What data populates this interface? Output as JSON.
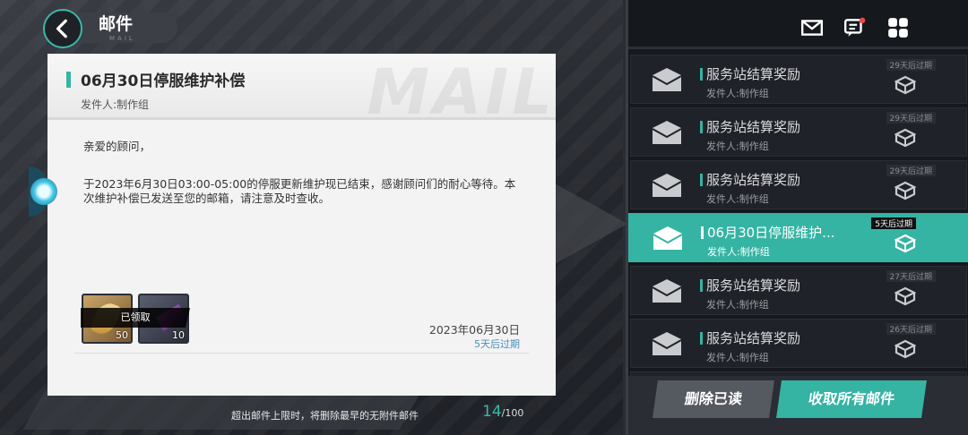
{
  "header": {
    "title": "邮件",
    "subtitle": "MAIL",
    "back_icon": "back-arrow-icon"
  },
  "mail_detail": {
    "watermark": "MAIL",
    "title": "06月30日停服维护补偿",
    "sender_label": "发件人:",
    "sender": "制作组",
    "greeting": "亲爱的顾问，",
    "body": "于2023年6月30日03:00-05:00的停服更新维护现已结束，感谢顾问们的耐心等待。本次维护补偿已发送至您的邮箱，请注意及时查收。",
    "attachments": [
      {
        "icon": "gold-crystal-icon",
        "count": "50"
      },
      {
        "icon": "purple-crystal-icon",
        "count": "10"
      }
    ],
    "claimed_label": "已领取",
    "date": "2023年06月30日",
    "expire": "5天后过期"
  },
  "footer": {
    "note": "超出邮件上限时，将删除最早的无附件邮件",
    "count": "14",
    "total": "/100"
  },
  "top_icons": [
    "mail-icon",
    "chat-icon",
    "menu-grid-icon"
  ],
  "mail_list": [
    {
      "title": "服务站结算奖励",
      "sender": "发件人:制作组",
      "expire": "29天后过期",
      "selected": false
    },
    {
      "title": "服务站结算奖励",
      "sender": "发件人:制作组",
      "expire": "29天后过期",
      "selected": false
    },
    {
      "title": "服务站结算奖励",
      "sender": "发件人:制作组",
      "expire": "29天后过期",
      "selected": false
    },
    {
      "title": "06月30日停服维护...",
      "sender": "发件人:制作组",
      "expire": "5天后过期",
      "selected": true
    },
    {
      "title": "服务站结算奖励",
      "sender": "发件人:制作组",
      "expire": "27天后过期",
      "selected": false
    },
    {
      "title": "服务站结算奖励",
      "sender": "发件人:制作组",
      "expire": "26天后过期",
      "selected": false
    },
    {
      "title": "",
      "sender": "",
      "expire": "26天后过期",
      "selected": false
    }
  ],
  "buttons": {
    "delete_read": "删除已读",
    "collect_all": "收取所有邮件"
  },
  "colors": {
    "accent": "#35b4a3",
    "panel_dark": "#15181d",
    "card_bg": "#f3f3f3"
  }
}
